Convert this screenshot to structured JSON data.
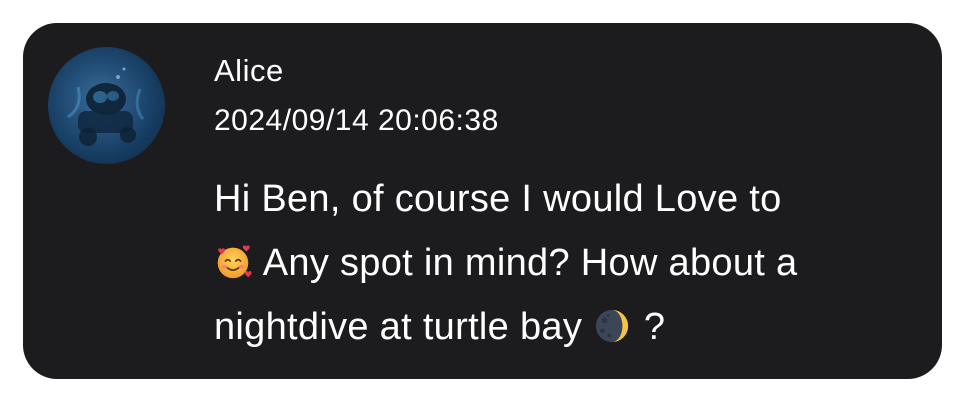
{
  "message": {
    "sender_name": "Alice",
    "timestamp": "2024/09/14 20:06:38",
    "lines": [
      {
        "before": "Hi Ben, of course I would Love to",
        "after": ""
      },
      {
        "before": "",
        "after": "  Any spot in mind? How about a"
      },
      {
        "before": "nightdive at turtle bay ",
        "after": " ?"
      }
    ],
    "emojis": [
      "smiling-face-with-hearts-icon",
      "waning-crescent-moon-icon"
    ]
  },
  "avatar": {
    "icon": "scuba-diver-photo"
  }
}
